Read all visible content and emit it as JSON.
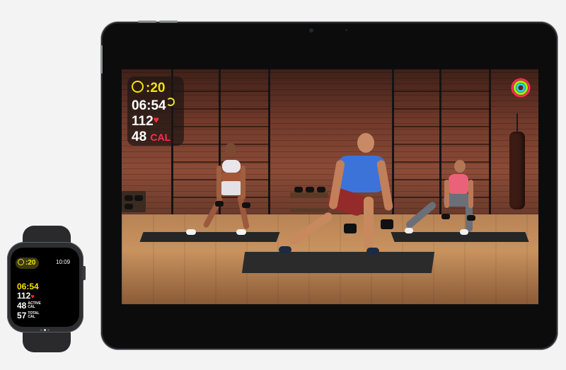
{
  "ipad_overlay": {
    "timer": ":20",
    "elapsed": "06:54",
    "heart_rate": "112",
    "calories": "48",
    "calories_unit": "CAL"
  },
  "watch": {
    "timer": ":20",
    "clock": "10:09",
    "elapsed": "06:54",
    "heart_rate": "112",
    "active_cal": "48",
    "active_label_1": "ACTIVE",
    "active_label_2": "CAL",
    "total_cal": "57",
    "total_label_1": "TOTAL",
    "total_label_2": "CAL",
    "page_count": 3,
    "current_page": 2
  },
  "colors": {
    "timer_yellow": "#f4e400",
    "heart_red": "#ff2d3b",
    "cal_pink": "#ff2d55",
    "ring_move": "#ff2d55",
    "ring_exercise": "#9bff00",
    "ring_stand": "#1fd7ff"
  },
  "icons": [
    "timer-icon",
    "heart-icon",
    "activity-rings-icon",
    "progress-ring-icon"
  ]
}
